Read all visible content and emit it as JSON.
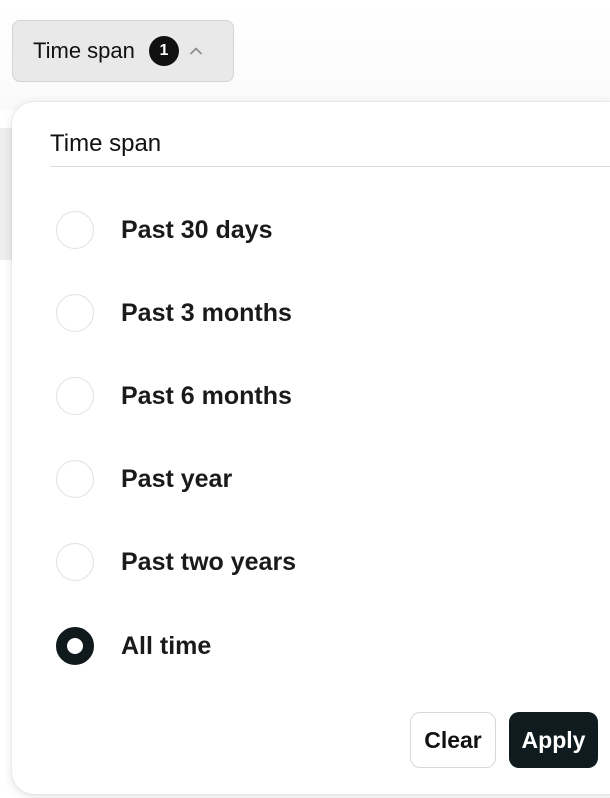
{
  "filter_button": {
    "label": "Time span",
    "count": "1",
    "icon": "chevron-up-icon"
  },
  "popover": {
    "title": "Time span",
    "options": [
      {
        "label": "Past 30 days",
        "selected": false
      },
      {
        "label": "Past 3 months",
        "selected": false
      },
      {
        "label": "Past 6 months",
        "selected": false
      },
      {
        "label": "Past year",
        "selected": false
      },
      {
        "label": "Past two years",
        "selected": false
      },
      {
        "label": "All time",
        "selected": true
      }
    ],
    "clear_label": "Clear",
    "apply_label": "Apply"
  },
  "colors": {
    "accent": "#0f1b1e",
    "badge": "#111111",
    "button_bg": "#e9e9e9"
  }
}
